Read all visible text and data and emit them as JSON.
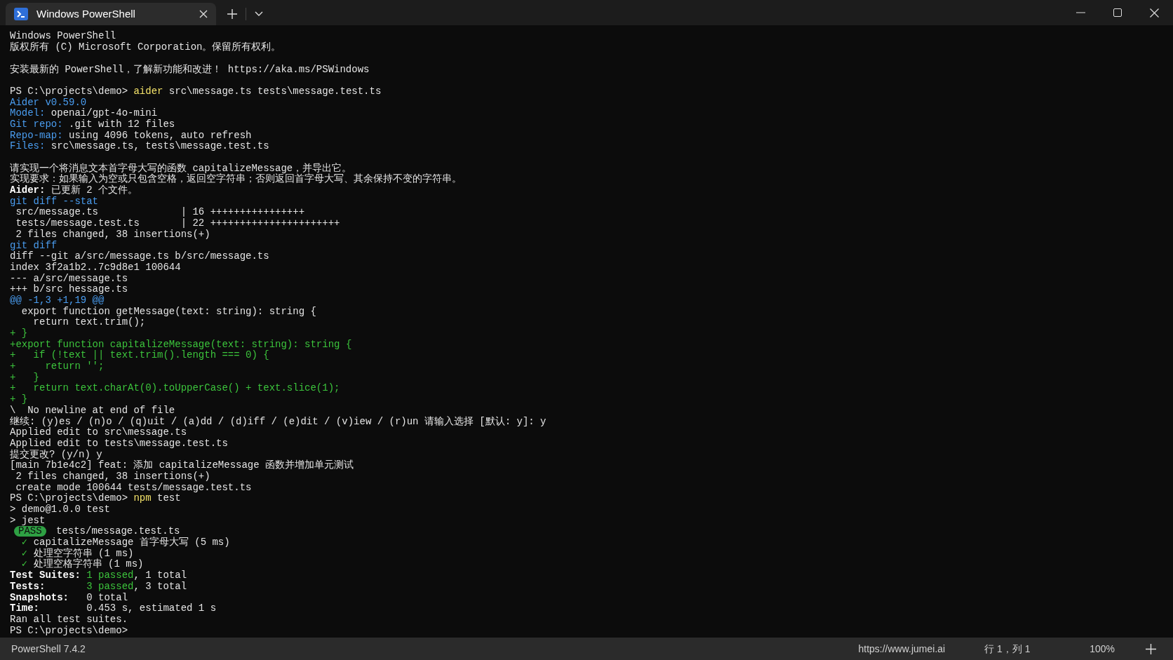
{
  "window": {
    "tab": {
      "title": "Windows PowerShell",
      "selected": true
    }
  },
  "terminal": {
    "lines": [
      {
        "segments": [
          {
            "text": "Windows PowerShell",
            "kind": "plain"
          }
        ]
      },
      {
        "segments": [
          {
            "text": "版权所有 (C) Microsoft Corporation。保留所有权利。",
            "kind": "plain"
          }
        ]
      },
      {
        "space_before": true,
        "segments": [
          {
            "text": "安装最新的 PowerShell，了解新功能和改进！ https://aka.ms/PSWindows",
            "kind": "plain"
          }
        ]
      },
      {
        "space_before": true,
        "segments": [
          {
            "text": "PS C:\\projects\\demo> ",
            "kind": "plain"
          },
          {
            "text": "aider",
            "kind": "yellow"
          },
          {
            "text": " src\\message.ts tests\\message.test.ts",
            "kind": "plain"
          }
        ]
      },
      {
        "segments": [
          {
            "text": "Aider v0.59.0",
            "kind": "blue"
          }
        ]
      },
      {
        "segments": [
          {
            "text": "Model:",
            "kind": "blue"
          },
          {
            "text": " openai/gpt-4o-mini",
            "kind": "plain"
          }
        ]
      },
      {
        "segments": [
          {
            "text": "Git repo:",
            "kind": "blue"
          },
          {
            "text": " .git with 12 files",
            "kind": "plain"
          }
        ]
      },
      {
        "segments": [
          {
            "text": "Repo-map:",
            "kind": "blue"
          },
          {
            "text": " using 4096 tokens, auto refresh",
            "kind": "plain"
          }
        ]
      },
      {
        "segments": [
          {
            "text": "Files:",
            "kind": "blue"
          },
          {
            "text": " src\\message.ts, tests\\message.test.ts",
            "kind": "plain"
          }
        ]
      },
      {
        "space_before": true,
        "segments": [
          {
            "text": "请实现一个将消息文本首字母大写的函数 capitalizeMessage，并导出它。",
            "kind": "plain"
          }
        ]
      },
      {
        "segments": [
          {
            "text": "实现要求：如果输入为空或只包含空格，返回空字符串；否则返回首字母大写、其余保持不变的字符串。",
            "kind": "plain"
          }
        ]
      },
      {
        "segments": [
          {
            "text": "Aider:",
            "kind": "bold"
          },
          {
            "text": " 已更新 2 个文件。",
            "kind": "plain"
          }
        ]
      },
      {
        "segments": [
          {
            "text": "git diff --stat",
            "kind": "blue"
          }
        ]
      },
      {
        "segments": [
          {
            "text": " src/message.ts              | 16 ++++++++++++++++",
            "kind": "plain"
          }
        ]
      },
      {
        "segments": [
          {
            "text": " tests/message.test.ts       | 22 ++++++++++++++++++++++",
            "kind": "plain"
          }
        ]
      },
      {
        "segments": [
          {
            "text": " 2 files changed, 38 insertions(+)",
            "kind": "plain"
          }
        ]
      },
      {
        "segments": [
          {
            "text": "git diff",
            "kind": "blue"
          }
        ]
      },
      {
        "segments": [
          {
            "text": "diff --git a/src/message.ts b/src/message.ts",
            "kind": "plain"
          }
        ]
      },
      {
        "segments": [
          {
            "text": "index 3f2a1b2..7c9d8e1 100644",
            "kind": "plain"
          }
        ]
      },
      {
        "segments": [
          {
            "text": "--- a/src/message.ts",
            "kind": "plain"
          }
        ]
      },
      {
        "segments": [
          {
            "text": "+++ b/src hessage.ts",
            "kind": "plain"
          }
        ]
      },
      {
        "segments": [
          {
            "text": "@@ -1,3 +1,19 @@",
            "kind": "blue"
          }
        ]
      },
      {
        "segments": [
          {
            "text": "  export function getMessage(text: string): string {",
            "kind": "plain"
          }
        ]
      },
      {
        "segments": [
          {
            "text": "    return text.trim();",
            "kind": "plain"
          }
        ]
      },
      {
        "segments": [
          {
            "text": "+ }",
            "kind": "green"
          }
        ]
      },
      {
        "segments": [
          {
            "text": "+export function capitalizeMessage(text: string): string {",
            "kind": "green"
          }
        ]
      },
      {
        "segments": [
          {
            "text": "+   if (!text || text.trim().length === 0) {",
            "kind": "green"
          }
        ]
      },
      {
        "segments": [
          {
            "text": "+     return '';",
            "kind": "green"
          }
        ]
      },
      {
        "segments": [
          {
            "text": "+   }",
            "kind": "green"
          }
        ]
      },
      {
        "segments": [
          {
            "text": "+   return text.charAt(0).toUpperCase() + text.slice(1);",
            "kind": "green"
          }
        ]
      },
      {
        "segments": [
          {
            "text": "+ }",
            "kind": "green"
          }
        ]
      },
      {
        "segments": [
          {
            "text": "\\  No newline at end of file",
            "kind": "plain"
          }
        ]
      },
      {
        "segments": [
          {
            "text": "继续: (y)es / (n)o / (q)uit / (a)dd / (d)iff / (e)dit / (v)iew / (r)un 请输入选择 [默认: y]: y",
            "kind": "plain"
          }
        ]
      },
      {
        "segments": [
          {
            "text": "Applied edit to src\\message.ts",
            "kind": "plain"
          }
        ]
      },
      {
        "segments": [
          {
            "text": "Applied edit to tests\\message.test.ts",
            "kind": "plain"
          }
        ]
      },
      {
        "segments": [
          {
            "text": "提交更改? (y/n) y",
            "kind": "plain"
          }
        ]
      },
      {
        "segments": [
          {
            "text": "[main 7b1e4c2] feat: 添加 capitalizeMessage 函数并增加单元测试",
            "kind": "plain"
          }
        ]
      },
      {
        "segments": [
          {
            "text": " 2 files changed, 38 insertions(+)",
            "kind": "plain"
          }
        ]
      },
      {
        "segments": [
          {
            "text": " create mode 100644 tests/message.test.ts",
            "kind": "plain"
          }
        ]
      },
      {
        "segments": [
          {
            "text": "PS C:\\projects\\demo> ",
            "kind": "plain"
          },
          {
            "text": "npm",
            "kind": "yellow"
          },
          {
            "text": " test",
            "kind": "plain"
          }
        ]
      },
      {
        "segments": [
          {
            "text": "> demo@1.0.0 test",
            "kind": "plain"
          }
        ]
      },
      {
        "segments": [
          {
            "text": "> jest",
            "kind": "plain"
          }
        ]
      },
      {
        "segments": [
          {
            "text": "PASS",
            "kind": "badge"
          },
          {
            "text": " tests/message.test.ts",
            "kind": "plain"
          }
        ]
      },
      {
        "segments": [
          {
            "text": "  ✓",
            "kind": "green"
          },
          {
            "text": " capitalizeMessage 首字母大写 (5 ms)",
            "kind": "plain"
          }
        ]
      },
      {
        "segments": [
          {
            "text": "  ✓",
            "kind": "green"
          },
          {
            "text": " 处理空字符串 (1 ms)",
            "kind": "plain"
          }
        ]
      },
      {
        "segments": [
          {
            "text": "  ✓",
            "kind": "green"
          },
          {
            "text": " 处理空格字符串 (1 ms)",
            "kind": "plain"
          }
        ]
      },
      {
        "segments": [
          {
            "text": "Test Suites: ",
            "kind": "bold"
          },
          {
            "text": "1 passed",
            "kind": "green"
          },
          {
            "text": ", 1 total",
            "kind": "plain"
          }
        ]
      },
      {
        "segments": [
          {
            "text": "Tests:       ",
            "kind": "bold"
          },
          {
            "text": "3 passed",
            "kind": "green"
          },
          {
            "text": ", 3 total",
            "kind": "plain"
          }
        ]
      },
      {
        "segments": [
          {
            "text": "Snapshots:",
            "kind": "bold"
          },
          {
            "text": "   0 total",
            "kind": "plain"
          }
        ]
      },
      {
        "segments": [
          {
            "text": "Time:",
            "kind": "bold"
          },
          {
            "text": "        0.453 s, estimated 1 s",
            "kind": "plain"
          }
        ]
      },
      {
        "segments": [
          {
            "text": "Ran all test suites.",
            "kind": "plain"
          }
        ]
      },
      {
        "segments": [
          {
            "text": "PS C:\\projects\\demo>",
            "kind": "plain"
          }
        ]
      }
    ]
  },
  "status_bar": {
    "left": "PowerShell 7.4.2",
    "url": "https://www.jumei.ai",
    "position": "行 1，列 1",
    "zoom": "100%"
  }
}
